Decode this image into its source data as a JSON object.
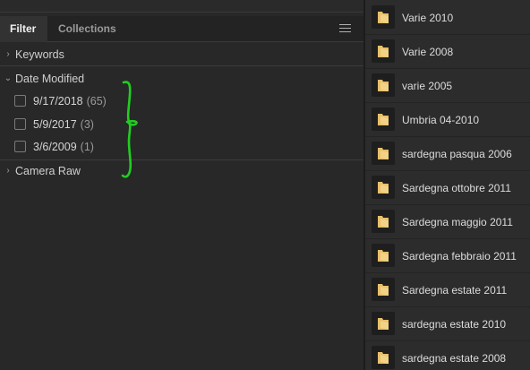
{
  "filter_panel": {
    "tabs": [
      {
        "label": "Filter",
        "active": true
      },
      {
        "label": "Collections",
        "active": false
      }
    ],
    "menu_icon": "hamburger-menu-icon",
    "sections": [
      {
        "label": "Keywords",
        "expanded": false
      },
      {
        "label": "Date Modified",
        "expanded": true
      },
      {
        "label": "Camera Raw",
        "expanded": false
      }
    ],
    "date_items": [
      {
        "date": "9/17/2018",
        "count": "(65)",
        "checked": false
      },
      {
        "date": "5/9/2017",
        "count": "(3)",
        "checked": false
      },
      {
        "date": "3/6/2009",
        "count": "(1)",
        "checked": false
      }
    ],
    "annotation": {
      "shape": "curly-brace",
      "color": "#22cc22"
    }
  },
  "folder_list": {
    "icon": "folder-icon",
    "folder_color": "#e8c06a",
    "items": [
      "Varie 2010",
      "Varie 2008",
      "varie 2005",
      "Umbria 04-2010",
      "sardegna pasqua 2006",
      "Sardegna ottobre 2011",
      "Sardegna maggio 2011",
      "Sardegna febbraio 2011",
      "Sardegna estate 2011",
      "sardegna estate 2010",
      "sardegna estate 2008"
    ]
  }
}
